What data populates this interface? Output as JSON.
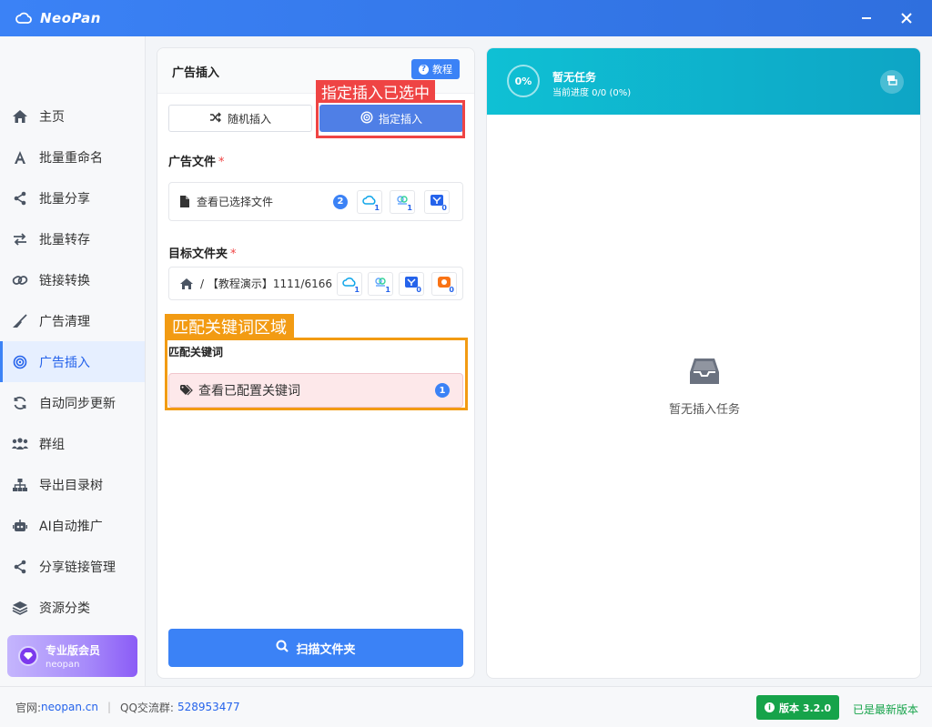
{
  "app": {
    "title": "NeoPan"
  },
  "sidebar": {
    "items": [
      {
        "label": "主页",
        "icon": "home-icon"
      },
      {
        "label": "批量重命名",
        "icon": "font-icon"
      },
      {
        "label": "批量分享",
        "icon": "share-icon"
      },
      {
        "label": "批量转存",
        "icon": "transfer-icon"
      },
      {
        "label": "链接转换",
        "icon": "link-icon"
      },
      {
        "label": "广告清理",
        "icon": "broom-icon"
      },
      {
        "label": "广告插入",
        "icon": "target-icon"
      },
      {
        "label": "自动同步更新",
        "icon": "sync-icon"
      },
      {
        "label": "群组",
        "icon": "users-icon"
      },
      {
        "label": "导出目录树",
        "icon": "sitemap-icon"
      },
      {
        "label": "AI自动推广",
        "icon": "robot-icon"
      },
      {
        "label": "分享链接管理",
        "icon": "share-icon"
      },
      {
        "label": "资源分类",
        "icon": "layers-icon"
      }
    ],
    "active_index": 6,
    "pro": {
      "title": "专业版会员",
      "user": "neopan"
    }
  },
  "panel": {
    "title": "广告插入",
    "tutorial_label": "教程",
    "mode_random": "随机插入",
    "mode_fixed": "指定插入",
    "ad_file_label": "广告文件",
    "required_mark": "*",
    "ad_file_text": "查看已选择文件",
    "ad_file_count": "2",
    "ad_file_cloud_counts": [
      "1",
      "1",
      "0"
    ],
    "target_label": "目标文件夹",
    "target_path": "/ 【教程演示】1111/6166",
    "target_cloud_counts": [
      "1",
      "1",
      "0",
      "0"
    ],
    "keyword_label": "匹配关键词",
    "keyword_text": "查看已配置关键词",
    "keyword_count": "1",
    "scan_label": "扫描文件夹"
  },
  "annotations": {
    "fixed_selected": "指定插入已选中",
    "keyword_area": "匹配关键词区域"
  },
  "task": {
    "percent": "0%",
    "title": "暂无任务",
    "progress_text": "当前进度 0/0 (0%)",
    "empty_text": "暂无插入任务"
  },
  "footer": {
    "site_label": "官网:",
    "site": "neopan.cn",
    "qq_label": "QQ交流群:",
    "qq": "528953477",
    "version": "版本 3.2.0",
    "latest": "已是最新版本"
  },
  "colors": {
    "primary": "#3b82f6",
    "accent_teal": "#0fc0d4",
    "success": "#16a34a",
    "annotation_red": "#ef4444",
    "annotation_orange": "#f29b13"
  }
}
